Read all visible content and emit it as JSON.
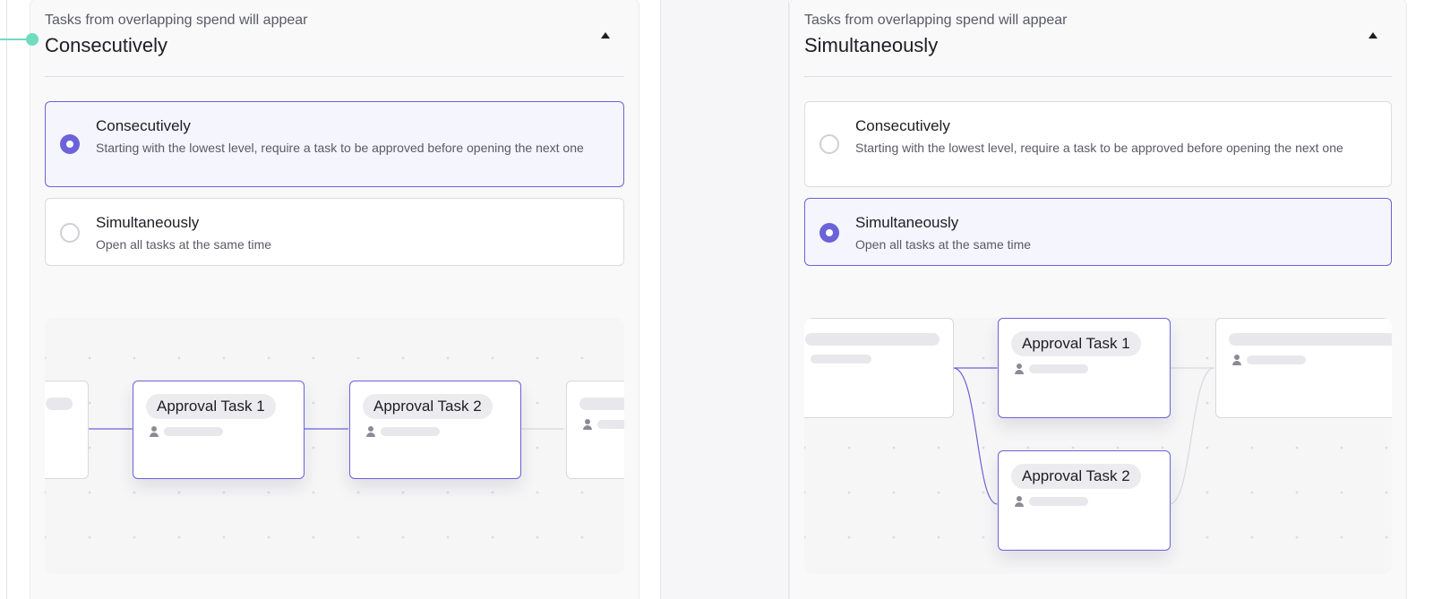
{
  "left_panel": {
    "header": {
      "subtitle": "Tasks from overlapping spend will appear",
      "selected": "Consecutively"
    },
    "options": [
      {
        "title": "Consecutively",
        "description": "Starting with the lowest level, require a task to be approved before opening the next one",
        "selected": true
      },
      {
        "title": "Simultaneously",
        "description": "Open all tasks at the same time",
        "selected": false
      }
    ],
    "flow": {
      "task1": "Approval Task 1",
      "task2": "Approval Task 2"
    }
  },
  "right_panel": {
    "header": {
      "subtitle": "Tasks from overlapping spend will appear",
      "selected": "Simultaneously"
    },
    "options": [
      {
        "title": "Consecutively",
        "description": "Starting with the lowest level, require a task to be approved before opening the next one",
        "selected": false
      },
      {
        "title": "Simultaneously",
        "description": "Open all tasks at the same time",
        "selected": true
      }
    ],
    "flow": {
      "task1": "Approval Task 1",
      "task2": "Approval Task 2"
    }
  },
  "colors": {
    "accent": "#6b63d8",
    "connector": "#6fdcc0"
  },
  "icons": {
    "chevron": "chevron-up-icon",
    "assignee": "person-icon"
  }
}
